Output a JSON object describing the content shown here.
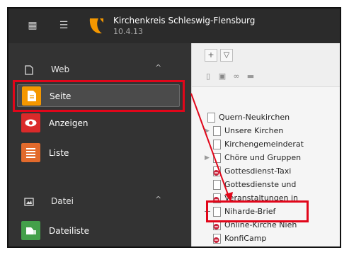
{
  "topbar": {
    "site_name": "Kirchenkreis Schleswig-Flensburg",
    "version": "10.4.13",
    "apps_icon": "apps-grid-icon",
    "list_icon": "module-list-icon",
    "logo_icon": "typo3-logo-icon"
  },
  "modules": {
    "web_group": {
      "label": "Web",
      "icon": "file-icon"
    },
    "web_items": [
      {
        "label": "Seite",
        "icon": "page-icon",
        "color": "#f49700",
        "active": true
      },
      {
        "label": "Anzeigen",
        "icon": "eye-icon",
        "color": "#da2a2a"
      },
      {
        "label": "Liste",
        "icon": "list-icon",
        "color": "#e26a2c"
      }
    ],
    "file_group": {
      "label": "Datei",
      "icon": "image-icon"
    },
    "file_items": [
      {
        "label": "Dateiliste",
        "icon": "file-list-icon",
        "color": "#44a04a"
      }
    ]
  },
  "pagetree": {
    "toolbar_icons": [
      "new-page-icon",
      "filter-icon",
      "page-icon",
      "page-move-icon",
      "link-icon",
      "folder-icon"
    ],
    "nodes": [
      {
        "label": "Quern-Neukirchen",
        "toggle": "",
        "icon": "page-icon"
      },
      {
        "label": "Unsere Kirchen",
        "toggle": "▶",
        "icon": "page-icon"
      },
      {
        "label": "Kirchengemeinderat",
        "toggle": "",
        "icon": "page-icon"
      },
      {
        "label": "Chöre und Gruppen",
        "toggle": "▶",
        "icon": "page-icon"
      },
      {
        "label": "Gottesdienst-Taxi",
        "toggle": "",
        "icon": "page-disabled-icon"
      },
      {
        "label": "Gottesdienste und",
        "toggle": "",
        "icon": "page-icon"
      },
      {
        "label": "Veranstaltungen in",
        "toggle": "",
        "icon": "page-disabled-icon"
      },
      {
        "label": "Niharde-Brief",
        "toggle": "",
        "icon": "page-icon"
      },
      {
        "label": "Online-Kirche Nieh",
        "toggle": "",
        "icon": "page-disabled-icon"
      },
      {
        "label": "KonfiCamp",
        "toggle": "",
        "icon": "page-disabled-icon"
      }
    ]
  },
  "annotations": {
    "highlight_color": "#e1061a"
  }
}
